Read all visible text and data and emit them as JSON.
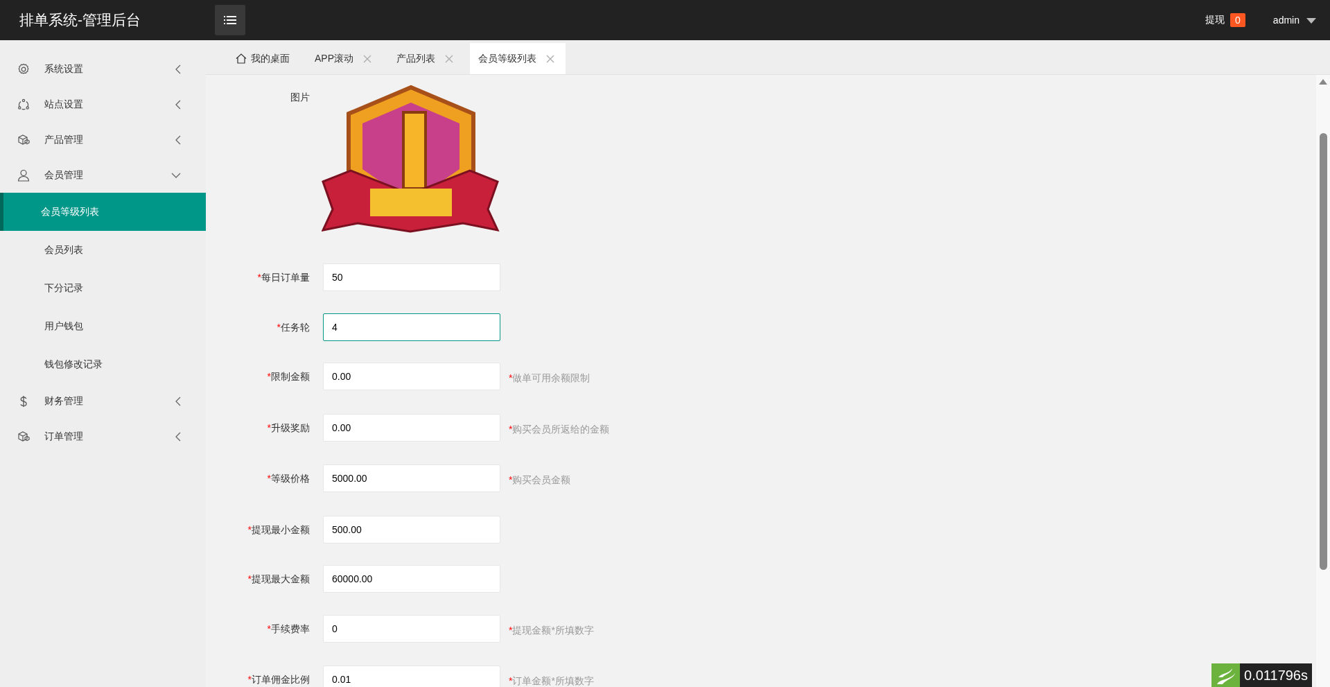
{
  "header": {
    "title": "排单系统-管理后台",
    "withdraw_label": "提现",
    "withdraw_count": "0",
    "user": "admin"
  },
  "sidebar": {
    "items": [
      {
        "label": "系统设置",
        "expanded": false
      },
      {
        "label": "站点设置",
        "expanded": false
      },
      {
        "label": "产品管理",
        "expanded": false
      },
      {
        "label": "会员管理",
        "expanded": true,
        "children": [
          {
            "label": "会员等级列表",
            "selected": true
          },
          {
            "label": "会员列表",
            "selected": false
          },
          {
            "label": "下分记录",
            "selected": false
          },
          {
            "label": "用户钱包",
            "selected": false
          },
          {
            "label": "钱包修改记录",
            "selected": false
          }
        ]
      },
      {
        "label": "财务管理",
        "expanded": false
      },
      {
        "label": "订单管理",
        "expanded": false
      }
    ]
  },
  "tabs": [
    {
      "label": "我的桌面",
      "selected": false,
      "kind": "home"
    },
    {
      "label": "APP滚动",
      "selected": false,
      "kind": "closable"
    },
    {
      "label": "产品列表",
      "selected": false,
      "kind": "closable"
    },
    {
      "label": "会员等级列表",
      "selected": true,
      "kind": "closable"
    }
  ],
  "form": {
    "image_label": "图片",
    "fields": [
      {
        "mark": "*",
        "label": "每日订单量",
        "value": "50",
        "focused": false
      },
      {
        "mark": "*",
        "label": "任务轮",
        "value": "4",
        "focused": true
      },
      {
        "mark": "*",
        "label": "限制金额",
        "value": "0.00",
        "focused": false,
        "hint_mark": "*",
        "hint": "做单可用余额限制"
      },
      {
        "mark": "*",
        "label": "升级奖励",
        "value": "0.00",
        "focused": false,
        "hint_mark": "*",
        "hint": "购买会员所返给的金额"
      },
      {
        "mark": "*",
        "label": "等级价格",
        "value": "5000.00",
        "focused": false,
        "hint_mark": "*",
        "hint": "购买会员金额"
      },
      {
        "mark": "*",
        "label": "提现最小金额",
        "value": "500.00",
        "focused": false
      },
      {
        "mark": "*",
        "label": "提现最大金额",
        "value": "60000.00",
        "focused": false
      },
      {
        "mark": "*",
        "label": "手续费率",
        "value": "0",
        "focused": false,
        "hint_mark": "*",
        "hint": "提现金额*所填数字"
      },
      {
        "mark": "*",
        "label": "订单佣金比例",
        "value": "0.01",
        "focused": false,
        "hint_mark": "*",
        "hint": "订单金额*所填数字"
      }
    ]
  },
  "debug": {
    "timing": "0.011796s"
  }
}
